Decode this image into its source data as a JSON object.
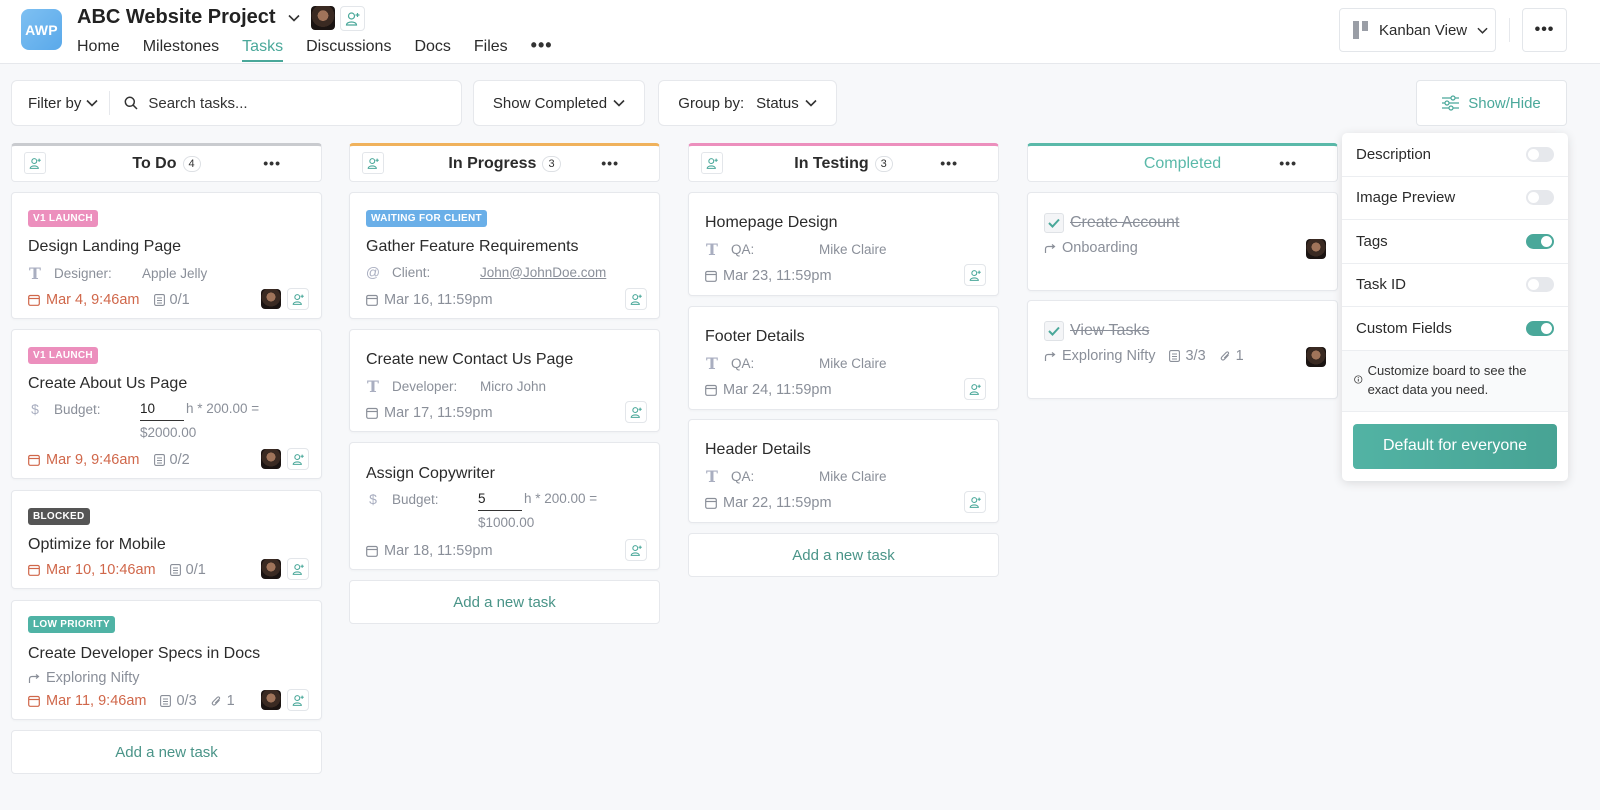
{
  "header": {
    "logo_text": "AWP",
    "project_title": "ABC Website Project",
    "nav": [
      {
        "label": "Home",
        "active": false
      },
      {
        "label": "Milestones",
        "active": false
      },
      {
        "label": "Tasks",
        "active": true
      },
      {
        "label": "Discussions",
        "active": false
      },
      {
        "label": "Docs",
        "active": false
      },
      {
        "label": "Files",
        "active": false
      }
    ],
    "nav_more": "•••",
    "view_button": "Kanban View",
    "more_button": "•••"
  },
  "toolbar": {
    "filter_label": "Filter by",
    "search_placeholder": "Search tasks...",
    "show_completed": "Show Completed",
    "group_by_label": "Group by:",
    "group_by_value": "Status",
    "show_hide": "Show/Hide"
  },
  "colors": {
    "accent": "#4aa89a",
    "todo": "#c9cbcf",
    "in_progress": "#f0b25c",
    "in_testing": "#ec8fbd",
    "completed": "#5ab9a9",
    "tag_v1": "#ec8fbd",
    "tag_waiting": "#6aafe8",
    "tag_blocked": "#555555",
    "tag_low": "#4fb3a5",
    "overdue": "#d0674a"
  },
  "columns": [
    {
      "title": "To Do",
      "count": "4",
      "cards": [
        {
          "tag": "V1 LAUNCH",
          "title": "Design Landing Page",
          "field_label": "Designer:",
          "field_value": "Apple Jelly",
          "date": "Mar 4, 9:46am",
          "checklist": "0/1"
        },
        {
          "tag": "V1 LAUNCH",
          "title": "Create About Us Page",
          "field_label": "Budget:",
          "budget_hours": "10",
          "budget_rate": "h * 200.00 =",
          "budget_total": "$2000.00",
          "date": "Mar 9, 9:46am",
          "checklist": "0/2"
        },
        {
          "tag": "BLOCKED",
          "title": "Optimize for Mobile",
          "date": "Mar 10, 10:46am",
          "checklist": "0/1"
        },
        {
          "tag": "LOW PRIORITY",
          "title": "Create Developer Specs in Docs",
          "parent": "Exploring Nifty",
          "date": "Mar 11, 9:46am",
          "checklist": "0/3",
          "attachments": "1"
        }
      ],
      "add_task": "Add a new task"
    },
    {
      "title": "In Progress",
      "count": "3",
      "cards": [
        {
          "tag": "WAITING FOR CLIENT",
          "title": "Gather Feature Requirements",
          "field_label": "Client:",
          "field_value": "John@JohnDoe.com",
          "date": "Mar 16, 11:59pm"
        },
        {
          "title": "Create new Contact Us Page",
          "field_label": "Developer:",
          "field_value": "Micro John",
          "date": "Mar 17, 11:59pm"
        },
        {
          "title": "Assign Copywriter",
          "field_label": "Budget:",
          "budget_hours": "5",
          "budget_rate": "h * 200.00 =",
          "budget_total": "$1000.00",
          "date": "Mar 18, 11:59pm"
        }
      ],
      "add_task": "Add a new task"
    },
    {
      "title": "In Testing",
      "count": "3",
      "cards": [
        {
          "title": "Homepage Design",
          "field_label": "QA:",
          "field_value": "Mike Claire",
          "date": "Mar 23, 11:59pm"
        },
        {
          "title": "Footer Details",
          "field_label": "QA:",
          "field_value": "Mike Claire",
          "date": "Mar 24, 11:59pm"
        },
        {
          "title": "Header Details",
          "field_label": "QA:",
          "field_value": "Mike Claire",
          "date": "Mar 22, 11:59pm"
        }
      ],
      "add_task": "Add a new task"
    },
    {
      "title": "Completed",
      "cards": [
        {
          "title": "Create Account",
          "parent": "Onboarding",
          "done": true
        },
        {
          "title": "View Tasks",
          "parent": "Exploring Nifty",
          "checklist": "3/3",
          "attachments": "1",
          "done": true
        }
      ]
    }
  ],
  "show_hide_panel": {
    "options": [
      {
        "label": "Description",
        "on": false
      },
      {
        "label": "Image Preview",
        "on": false
      },
      {
        "label": "Tags",
        "on": true
      },
      {
        "label": "Task ID",
        "on": false
      },
      {
        "label": "Custom Fields",
        "on": true
      }
    ],
    "info": "Customize board to see the exact data you need.",
    "default_button": "Default for everyone"
  }
}
